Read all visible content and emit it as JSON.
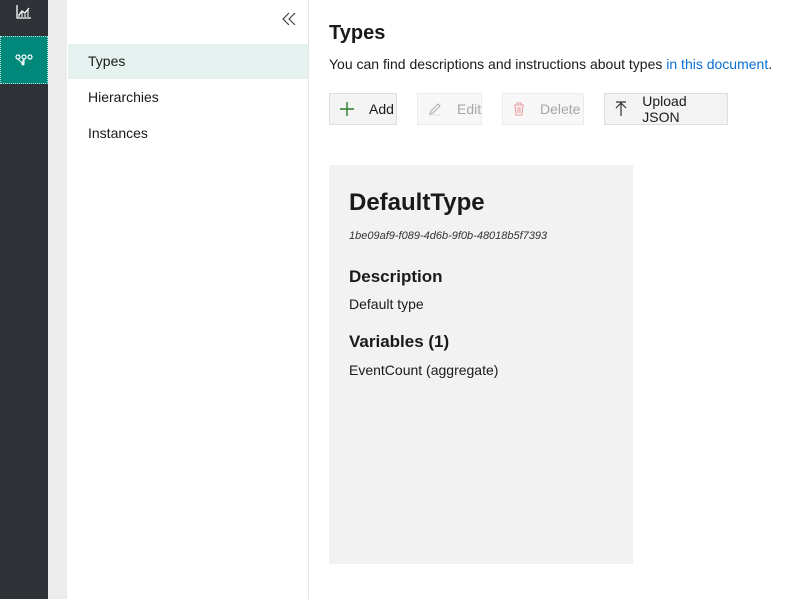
{
  "rail": {
    "items": [
      {
        "icon": "chart-icon",
        "active": false
      },
      {
        "icon": "model-hierarchy-icon",
        "active": true
      }
    ],
    "accent": "#00897b"
  },
  "nav": {
    "collapse_icon": "double-chevron-left-icon",
    "items": [
      {
        "label": "Types",
        "selected": true
      },
      {
        "label": "Hierarchies",
        "selected": false
      },
      {
        "label": "Instances",
        "selected": false
      }
    ]
  },
  "main": {
    "title": "Types",
    "subtitle_text": "You can find descriptions and instructions about types ",
    "subtitle_link": "in this document",
    "subtitle_end": ".",
    "link_color": "#0a6fd6",
    "toolbar": {
      "add_label": "Add",
      "edit_label": "Edit",
      "delete_label": "Delete",
      "upload_label": "Upload JSON"
    }
  },
  "type_card": {
    "name": "DefaultType",
    "id": "1be09af9-f089-4d6b-9f0b-48018b5f7393",
    "description_heading": "Description",
    "description": "Default type",
    "variables_heading": "Variables (1)",
    "variables": [
      "EventCount (aggregate)"
    ]
  }
}
